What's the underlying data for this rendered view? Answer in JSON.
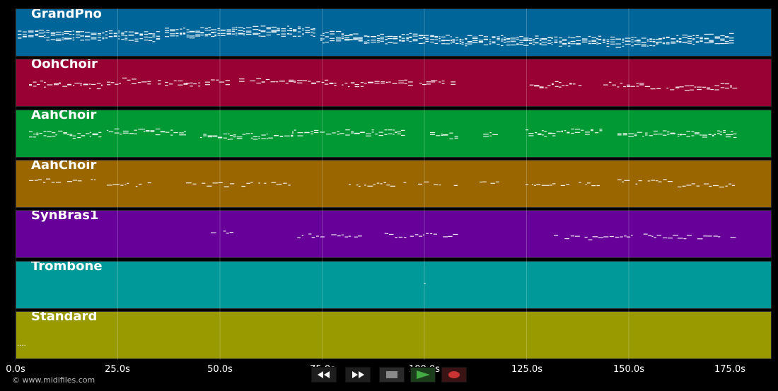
{
  "tracks": [
    {
      "name": "GrandPno",
      "color": "#006699",
      "density": 1.0,
      "segments": [
        [
          2,
          200
        ],
        [
          210,
          420
        ],
        [
          430,
          1010
        ]
      ],
      "lanes": 4
    },
    {
      "name": "OohChoir",
      "color": "#990033",
      "density": 0.5,
      "segments": [
        [
          18,
          120
        ],
        [
          128,
          190
        ],
        [
          200,
          240
        ],
        [
          240,
          300
        ],
        [
          315,
          450
        ],
        [
          460,
          560
        ],
        [
          570,
          620
        ],
        [
          720,
          800
        ],
        [
          830,
          1015
        ]
      ],
      "lanes": 2
    },
    {
      "name": "AahChoir",
      "color": "#009933",
      "density": 0.8,
      "segments": [
        [
          18,
          120
        ],
        [
          128,
          240
        ],
        [
          260,
          390
        ],
        [
          390,
          550
        ],
        [
          585,
          620
        ],
        [
          655,
          680
        ],
        [
          720,
          830
        ],
        [
          850,
          925
        ],
        [
          935,
          1015
        ]
      ],
      "lanes": 2
    },
    {
      "name": "AahChoir",
      "color": "#996600",
      "density": 0.5,
      "segments": [
        [
          18,
          120
        ],
        [
          128,
          190
        ],
        [
          240,
          390
        ],
        [
          470,
          550
        ],
        [
          568,
          620
        ],
        [
          655,
          680
        ],
        [
          720,
          830
        ],
        [
          850,
          925
        ],
        [
          935,
          1015
        ]
      ],
      "lanes": 1
    },
    {
      "name": "SynBras1",
      "color": "#660099",
      "density": 0.5,
      "segments": [
        [
          275,
          315
        ],
        [
          390,
          620
        ],
        [
          760,
          930
        ],
        [
          935,
          1015
        ]
      ],
      "lanes": 1
    },
    {
      "name": "Trombone",
      "color": "#009999",
      "density": 0.3,
      "segments": [
        [
          570,
          585
        ]
      ],
      "lanes": 1
    },
    {
      "name": "Standard",
      "color": "#999900",
      "density": 0.0,
      "segments": [],
      "lanes": 1,
      "dots": "...."
    }
  ],
  "time_labels": [
    "0.0s",
    "25.0s",
    "50.0s",
    "75.0s",
    "100.0s",
    "125.0s",
    "150.0s",
    "175.0s"
  ],
  "copyright": "© www.midifiles.com",
  "transport": [
    {
      "name": "rewind",
      "icon": "rewind-icon"
    },
    {
      "name": "fast-forward",
      "icon": "fast-forward-icon"
    },
    {
      "name": "stop",
      "icon": "stop-icon"
    },
    {
      "name": "play",
      "icon": "play-icon",
      "color": "#44aa44"
    },
    {
      "name": "record",
      "icon": "record-icon",
      "color": "#cc3333"
    }
  ]
}
